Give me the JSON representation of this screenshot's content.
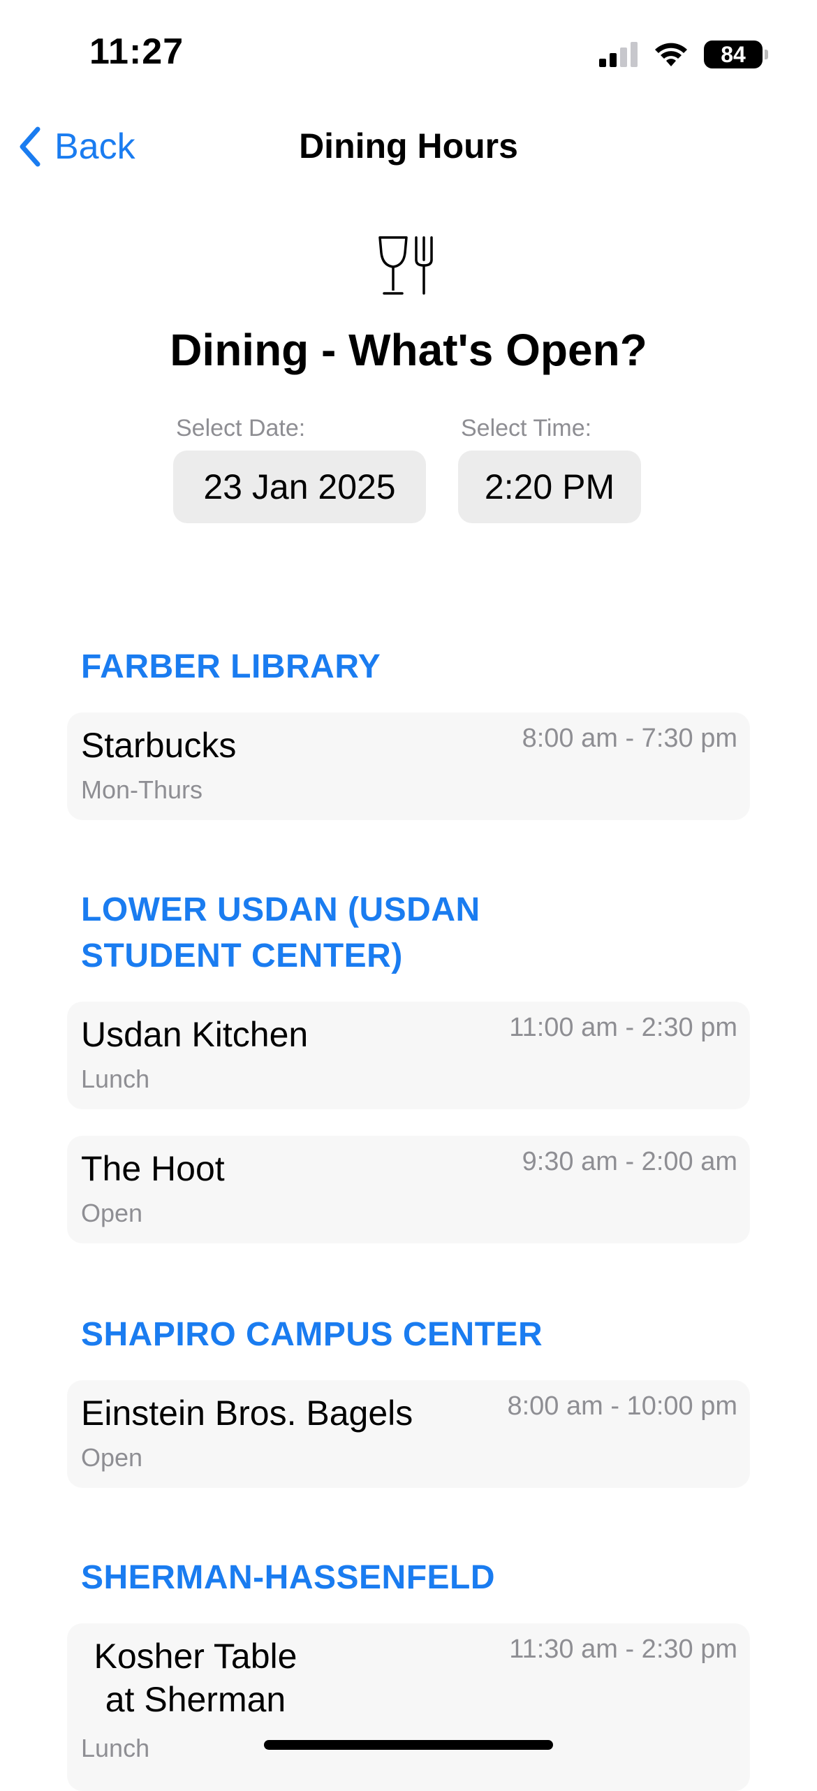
{
  "status_bar": {
    "time": "11:27",
    "battery": "84"
  },
  "nav": {
    "back_label": "Back",
    "title": "Dining Hours"
  },
  "header": {
    "title": "Dining - What's Open?",
    "icon": "dining-glass-fork-icon"
  },
  "pickers": {
    "date_label": "Select Date:",
    "date_value": "23 Jan 2025",
    "time_label": "Select Time:",
    "time_value": "2:20 PM"
  },
  "sections": [
    {
      "title": "FARBER LIBRARY",
      "items": [
        {
          "name": "Starbucks",
          "subtitle": "Mon-Thurs",
          "hours": "8:00 am - 7:30 pm"
        }
      ]
    },
    {
      "title": "LOWER USDAN (USDAN STUDENT CENTER)",
      "items": [
        {
          "name": "Usdan Kitchen",
          "subtitle": "Lunch",
          "hours": "11:00 am - 2:30 pm"
        },
        {
          "name": "The Hoot",
          "subtitle": "Open",
          "hours": "9:30 am - 2:00 am"
        }
      ]
    },
    {
      "title": "SHAPIRO CAMPUS CENTER",
      "items": [
        {
          "name": "Einstein Bros. Bagels",
          "subtitle": "Open",
          "hours": "8:00 am - 10:00 pm"
        }
      ]
    },
    {
      "title": "SHERMAN-HASSENFELD",
      "items": [
        {
          "name": "Kosher Table at Sherman",
          "subtitle": "Lunch",
          "hours": "11:30 am - 2:30 pm"
        }
      ]
    }
  ],
  "colors": {
    "accent": "#1a7cf0",
    "secondary_text": "#8e8e93",
    "card_bg": "#f7f7f7"
  }
}
